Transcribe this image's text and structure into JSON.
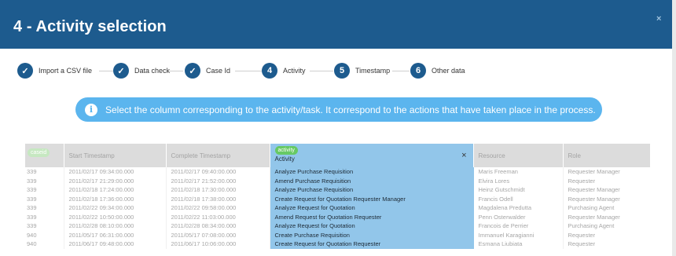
{
  "modal": {
    "title": "4 - Activity selection",
    "close": "×"
  },
  "stepper": [
    {
      "marker": "✓",
      "label": "Import a CSV file"
    },
    {
      "marker": "✓",
      "label": "Data check"
    },
    {
      "marker": "✓",
      "label": "Case Id"
    },
    {
      "marker": "4",
      "label": "Activity"
    },
    {
      "marker": "5",
      "label": "Timestamp"
    },
    {
      "marker": "6",
      "label": "Other data"
    }
  ],
  "banner": {
    "icon": "i",
    "text": "Select the column corresponding to the activity/task. It correspond to the actions that have taken place in the process."
  },
  "table": {
    "headers": {
      "caseid_tag": "caseid",
      "start": "Start Timestamp",
      "complete": "Complete Timestamp",
      "activity_tag": "activity",
      "activity": "Activity",
      "activity_remove": "×",
      "resource": "Resource",
      "role": "Role"
    },
    "rows": [
      [
        "339",
        "2011/02/17 09:34:00.000",
        "2011/02/17 09:40:00.000",
        "Analyze Purchase Requisition",
        "Maris Freeman",
        "Requester Manager"
      ],
      [
        "339",
        "2011/02/17 21:29:00.000",
        "2011/02/17 21:52:00.000",
        "Amend Purchase Requisition",
        "Elvira Lores",
        "Requester"
      ],
      [
        "339",
        "2011/02/18 17:24:00.000",
        "2011/02/18 17:30:00.000",
        "Analyze Purchase Requisition",
        "Heinz Gutschmidt",
        "Requester Manager"
      ],
      [
        "339",
        "2011/02/18 17:36:00.000",
        "2011/02/18 17:38:00.000",
        "Create Request for Quotation Requester Manager",
        "Francis Odell",
        "Requester Manager"
      ],
      [
        "339",
        "2011/02/22 09:34:00.000",
        "2011/02/22 09:58:00.000",
        "Analyze Request for Quotation",
        "Magdalena Predutta",
        "Purchasing Agent"
      ],
      [
        "339",
        "2011/02/22 10:50:00.000",
        "2011/02/22 11:03:00.000",
        "Amend Request for Quotation Requester",
        "Penn Osterwalder",
        "Requester Manager"
      ],
      [
        "339",
        "2011/02/28 08:10:00.000",
        "2011/02/28 08:34:00.000",
        "Analyze Request for Quotation",
        "Francois de Perrier",
        "Purchasing Agent"
      ],
      [
        "940",
        "2011/05/17 06:31:00.000",
        "2011/05/17 07:08:00.000",
        "Create Purchase Requisition",
        "Immanuel Karagianni",
        "Requester"
      ],
      [
        "940",
        "2011/06/17 09:48:00.000",
        "2011/06/17 10:06:00.000",
        "Create Request for Quotation Requester",
        "Esmana Liubiata",
        "Requester"
      ]
    ]
  },
  "colors": {
    "header": "#1d5b8e",
    "banner": "#5bb5ee",
    "selected_column": "#92c6ea",
    "tag": "#67c964"
  }
}
